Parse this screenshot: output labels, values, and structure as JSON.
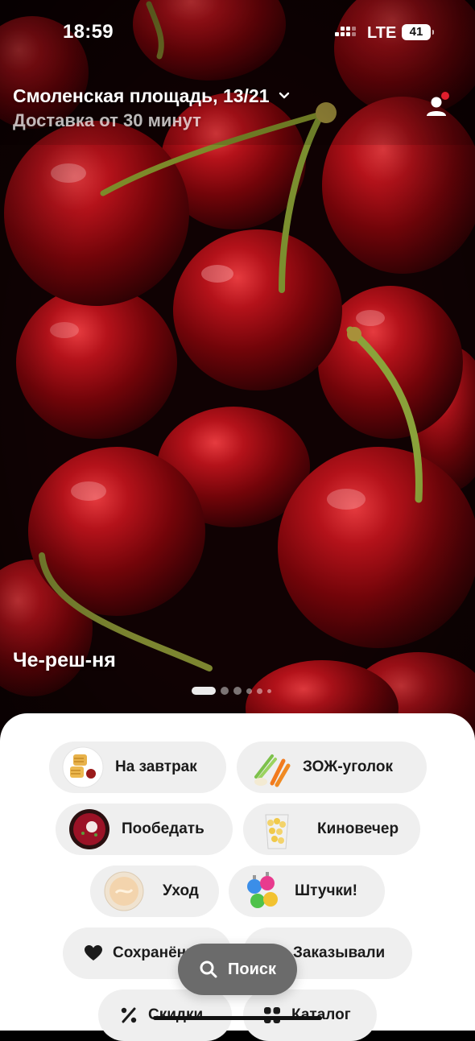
{
  "status_bar": {
    "time": "18:59",
    "network": "LTE",
    "battery": "41"
  },
  "header": {
    "address": "Смоленская площадь, 13/21",
    "delivery": "Доставка от 30 минут"
  },
  "story": {
    "title": "Че-реш-ня",
    "dots_total": 6,
    "dots_active": 1
  },
  "categories": [
    {
      "label": "На завтрак",
      "icon": "waffles-icon"
    },
    {
      "label": "ЗОЖ-уголок",
      "icon": "vegetables-icon"
    },
    {
      "label": "Пообедать",
      "icon": "soup-bowl-icon"
    },
    {
      "label": "Киновечер",
      "icon": "popcorn-icon"
    },
    {
      "label": "Уход",
      "icon": "cream-jar-icon"
    },
    {
      "label": "Штучки!",
      "icon": "lightbulbs-icon"
    },
    {
      "label": "Сохранённое",
      "icon": "heart-icon"
    },
    {
      "label": "Заказывали",
      "icon": "history-icon"
    },
    {
      "label": "Скидки",
      "icon": "percent-icon"
    },
    {
      "label": "Каталог",
      "icon": "grid-icon"
    }
  ],
  "search": {
    "label": "Поиск"
  },
  "colors": {
    "accent_red": "#e01e2d",
    "chip_bg": "#efefef",
    "search_bg": "#6b6b6b"
  }
}
